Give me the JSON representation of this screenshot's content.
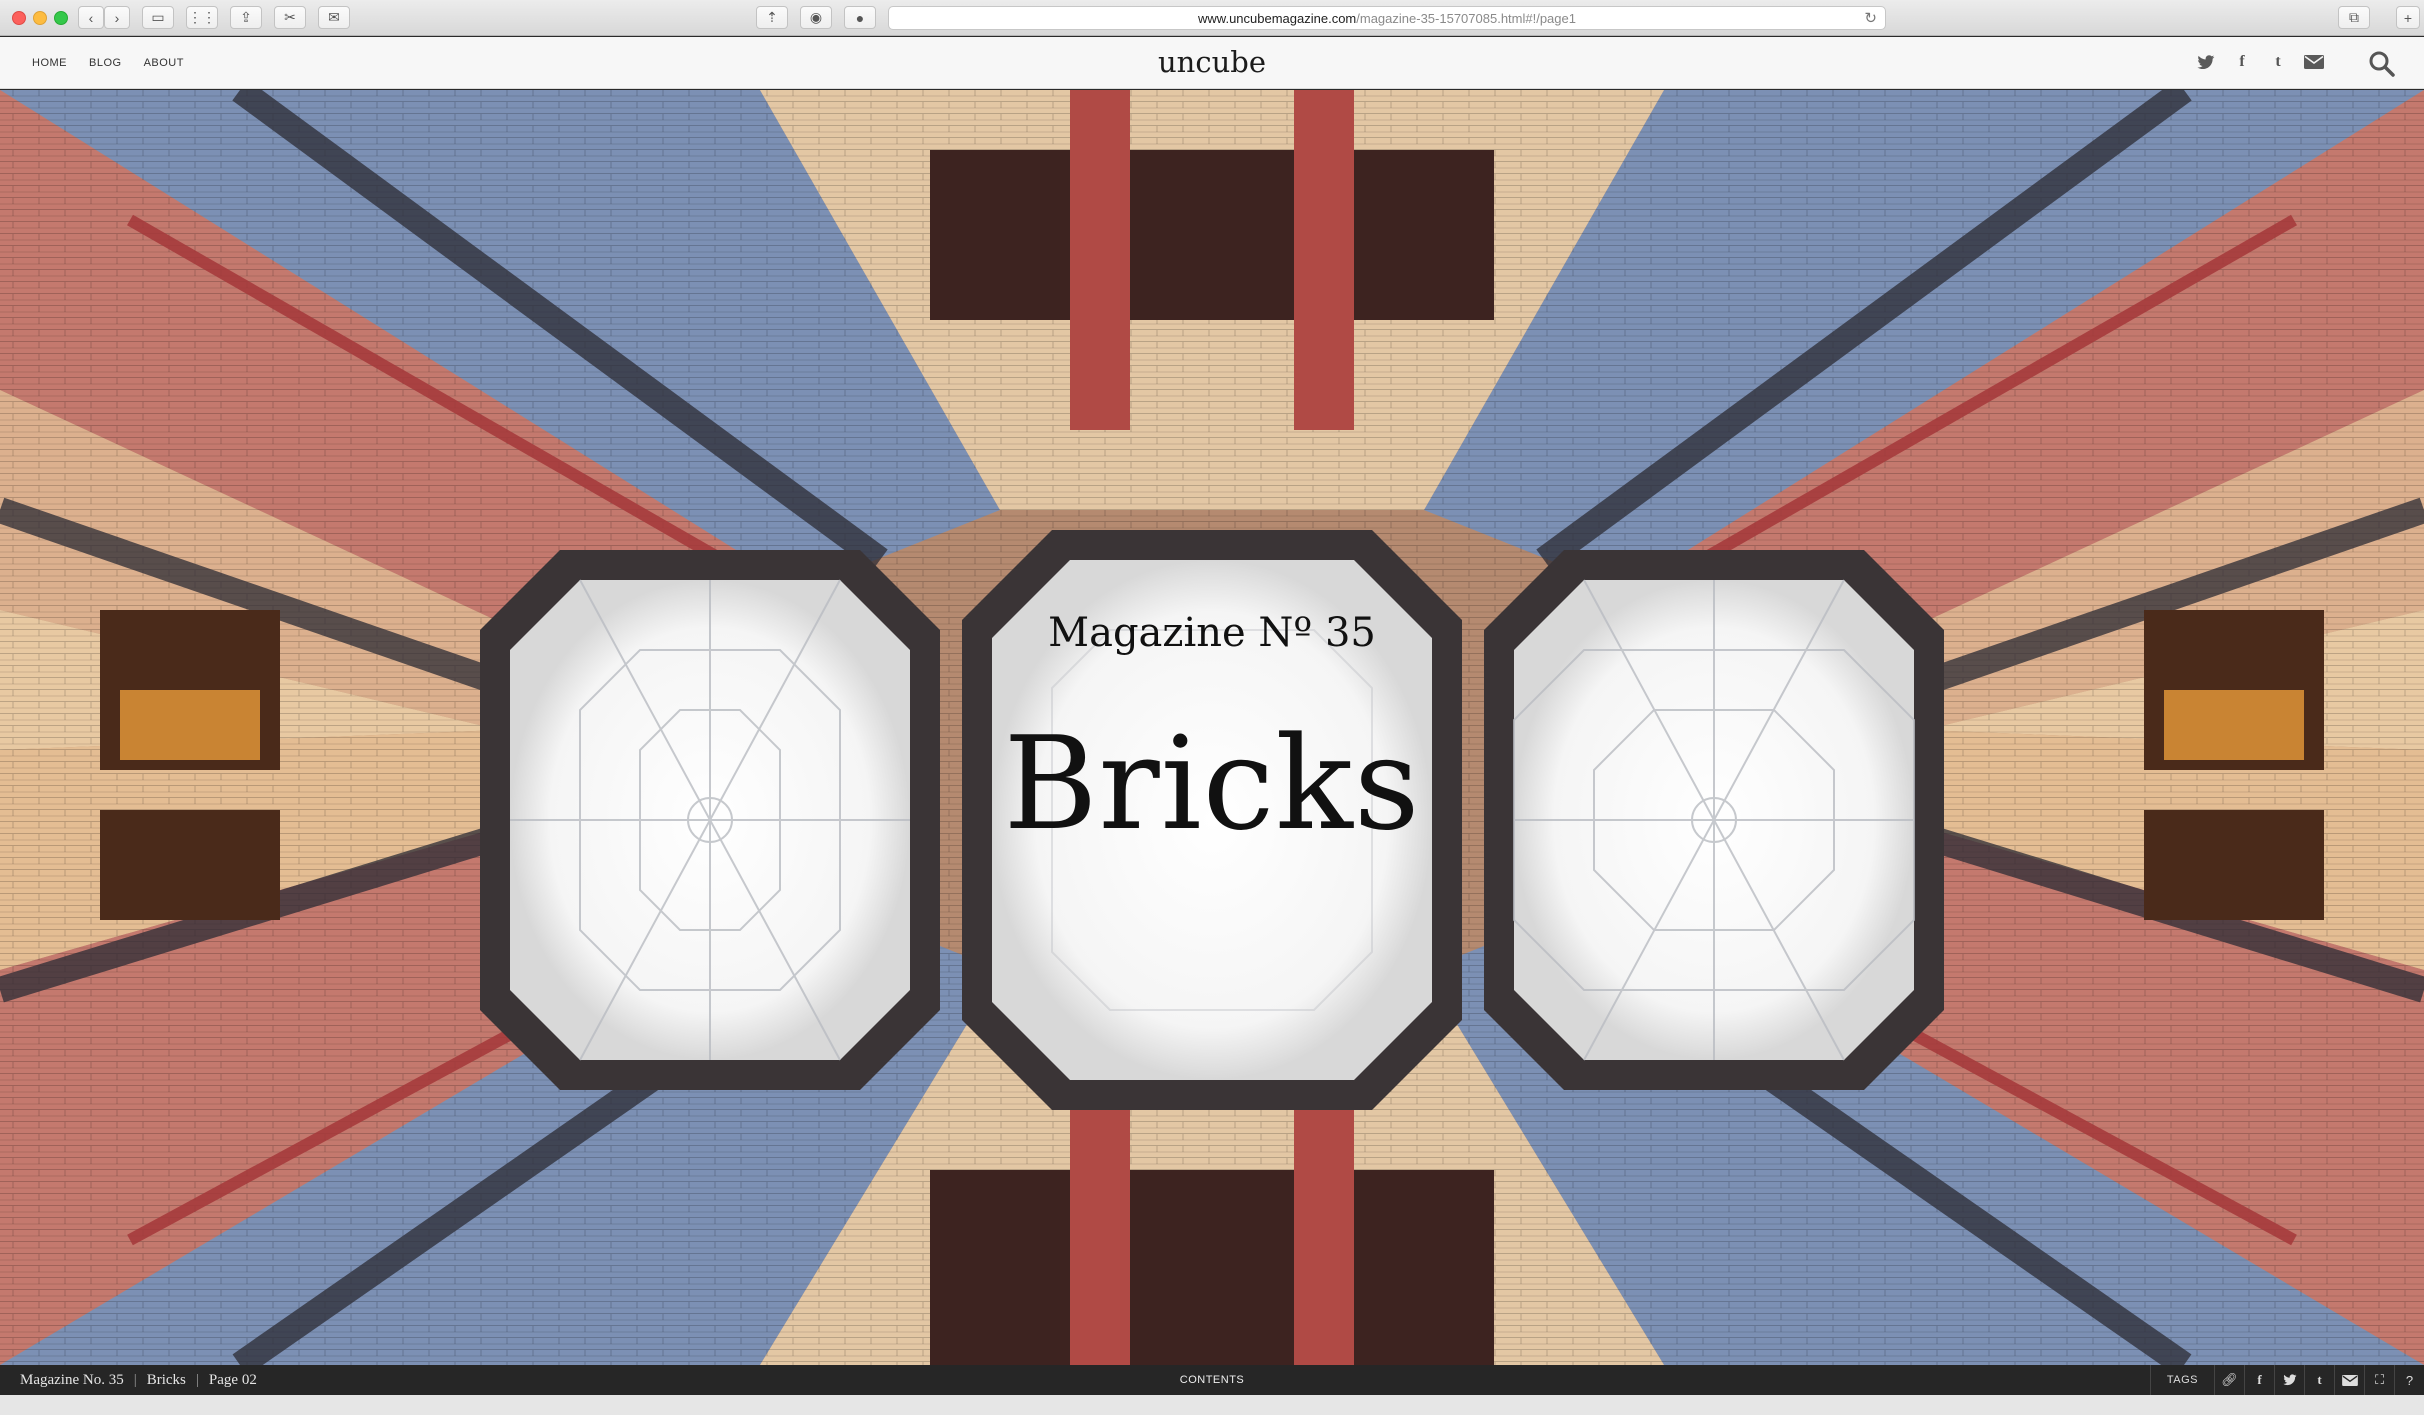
{
  "browser": {
    "url_domain": "www.uncubemagazine.com",
    "url_path": "/magazine-35-15707085.html#!/page1"
  },
  "header": {
    "nav": [
      "HOME",
      "BLOG",
      "ABOUT"
    ],
    "logo": "uncube",
    "social_icons": [
      "twitter-icon",
      "facebook-icon",
      "tumblr-icon",
      "email-icon"
    ],
    "search_icon": "search-icon"
  },
  "hero": {
    "kicker": "Magazine Nº 35",
    "title": "Bricks",
    "image_description_colors": [
      "#c9a57e",
      "#b0453f",
      "#6d86ad",
      "#e8d2b4",
      "#2f2f38"
    ]
  },
  "footer": {
    "crumbs": [
      "Magazine No. 35",
      "Bricks",
      "Page 02"
    ],
    "contents_label": "CONTENTS",
    "tags_label": "TAGS",
    "icons": [
      "link-icon",
      "facebook-icon",
      "twitter-icon",
      "tumblr-icon",
      "email-icon",
      "fullscreen-icon",
      "help-icon"
    ]
  }
}
